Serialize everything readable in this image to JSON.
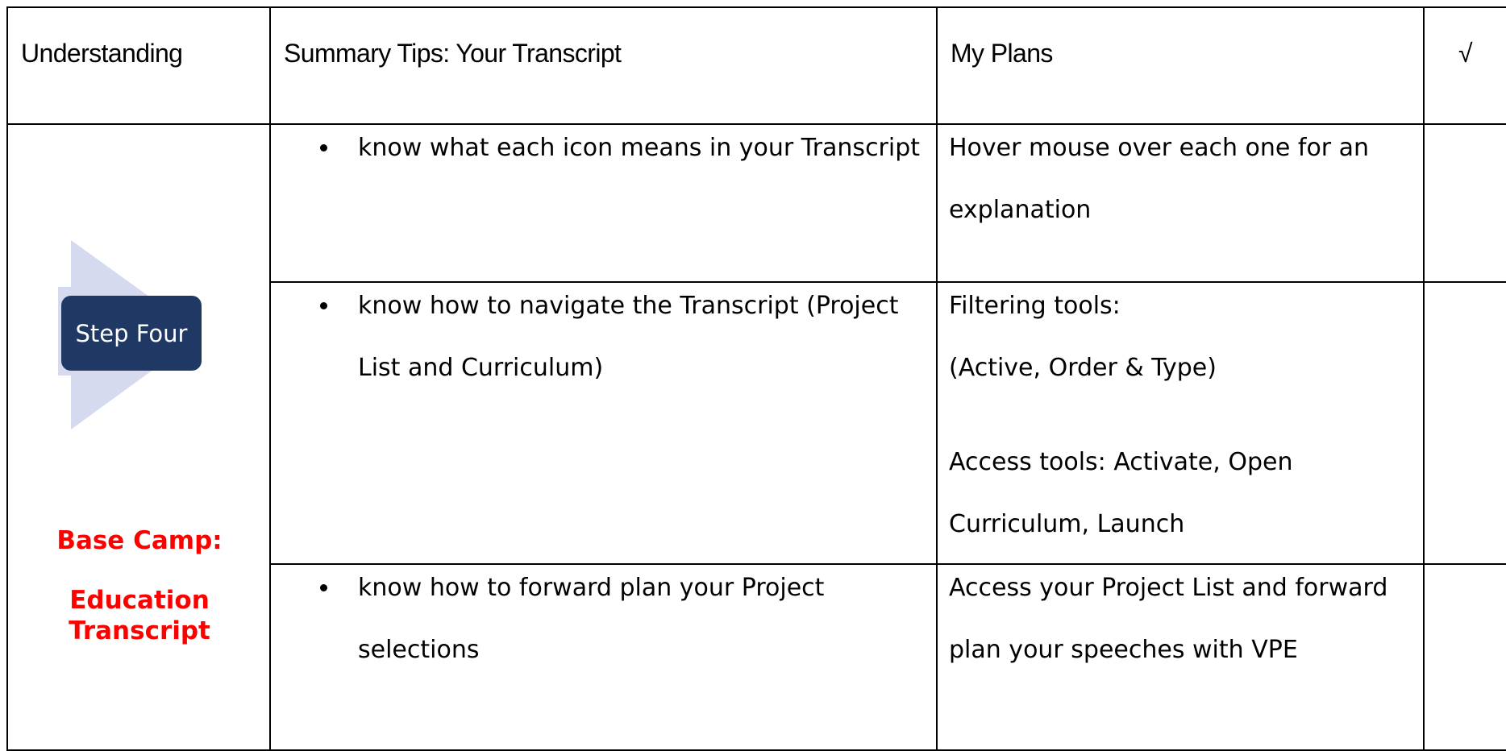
{
  "header": {
    "understanding": "Understanding",
    "summary_tips": "Summary Tips: Your Transcript",
    "my_plans": "My Plans",
    "check": "√"
  },
  "step": {
    "label": "Step Four",
    "title_line1": "Base Camp:",
    "title_line2": "Education Transcript",
    "box_color": "#1f3864",
    "arrow_color": "#d5daee",
    "title_color": "#ff0000"
  },
  "rows": [
    {
      "tip": "know what each icon means in your Transcript",
      "plans": [
        "Hover mouse over each one for an explanation"
      ]
    },
    {
      "tip": "know how to navigate the Transcript (Project List and Curriculum)",
      "plans": [
        "Filtering tools:",
        "(Active, Order & Type)",
        "Access tools: Activate, Open Curriculum, Launch"
      ]
    },
    {
      "tip": "know how to forward plan your Project selections",
      "plans": [
        "Access your Project List and forward plan your speeches with VPE"
      ]
    }
  ]
}
